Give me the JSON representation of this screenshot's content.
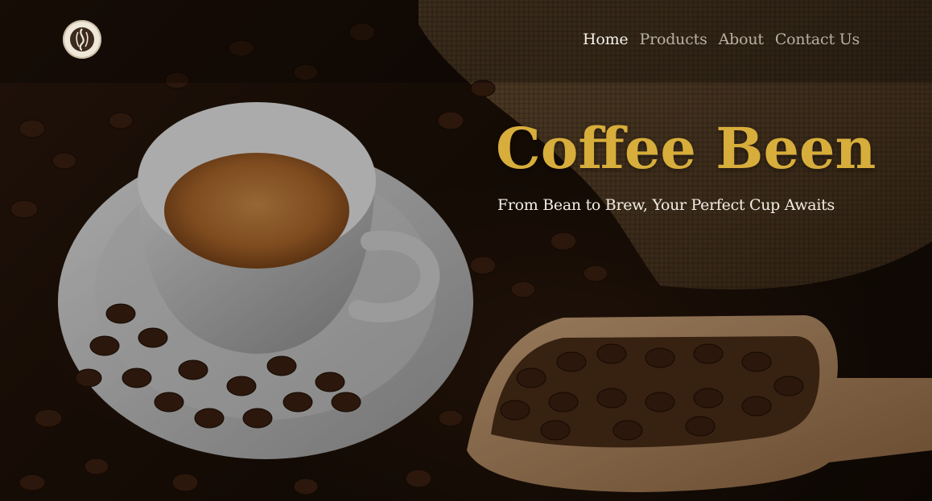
{
  "brand": {
    "logo_icon": "coffee-bean-logo-icon"
  },
  "nav": {
    "items": [
      {
        "label": "Home",
        "active": true
      },
      {
        "label": "Products",
        "active": false
      },
      {
        "label": "About",
        "active": false
      },
      {
        "label": "Contact Us",
        "active": false
      }
    ]
  },
  "hero": {
    "title": "Coffee Been",
    "tagline": "From Bean to Brew, Your Perfect Cup Awaits"
  },
  "colors": {
    "title": "#d7ad3b",
    "nav_active": "#f6f2ea",
    "nav_inactive": "#b9b1a4",
    "background": "#1a0f08"
  }
}
